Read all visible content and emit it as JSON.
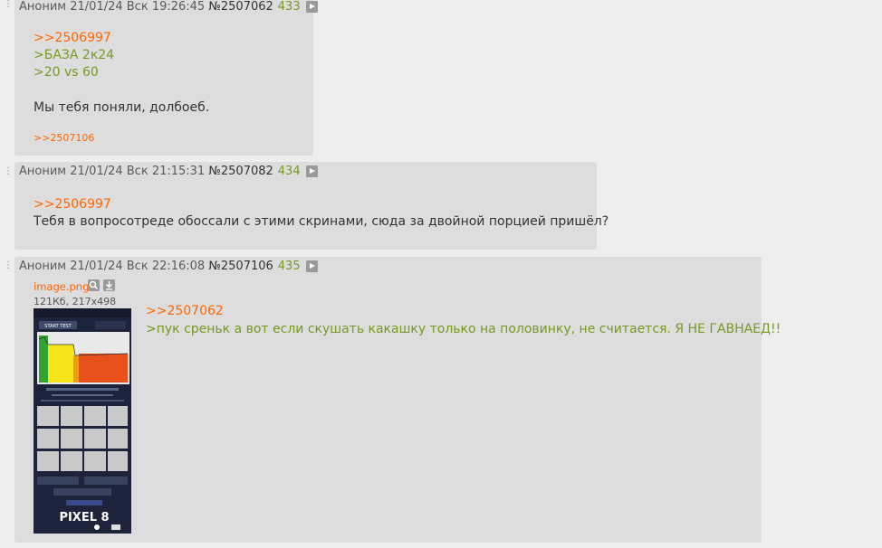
{
  "posts": [
    {
      "menu": "⋮⋮",
      "name": "Аноним",
      "date": "21/01/24 Вск 19:26:45",
      "num": "№2507062",
      "count": "433",
      "lines": [
        ">>2506997",
        ">БАЗА 2к24",
        ">20 vs 60",
        "Мы тебя поняли, долбоеб."
      ],
      "reply": ">>2507106"
    },
    {
      "menu": "⋮⋮",
      "name": "Аноним",
      "date": "21/01/24 Вск 21:15:31",
      "num": "№2507082",
      "count": "434",
      "lines": [
        ">>2506997",
        "Тебя в вопросотреде обоссали с этими скринами, сюда за двойной порцией пришёл?"
      ]
    },
    {
      "menu": "⋮⋮",
      "name": "Аноним",
      "date": "21/01/24 Вск 22:16:08",
      "num": "№2507106",
      "count": "435",
      "file": {
        "name": "image.png",
        "info": "121Кб, 217x498",
        "thumb_text": "PIXEL 8",
        "thumb_button": "START TEST"
      },
      "lines": [
        ">>2507062",
        ">пук среньк а вот если скушать какашку только на половинку, не считается. Я НЕ ГАВНАЕД!!"
      ]
    }
  ],
  "colors": {
    "background": "#eeeeee",
    "post_background": "#dddddd",
    "link": "#ff6600",
    "greentext": "#789922",
    "text": "#333333"
  },
  "icons": [
    "play-icon",
    "search-icon",
    "download-icon"
  ]
}
